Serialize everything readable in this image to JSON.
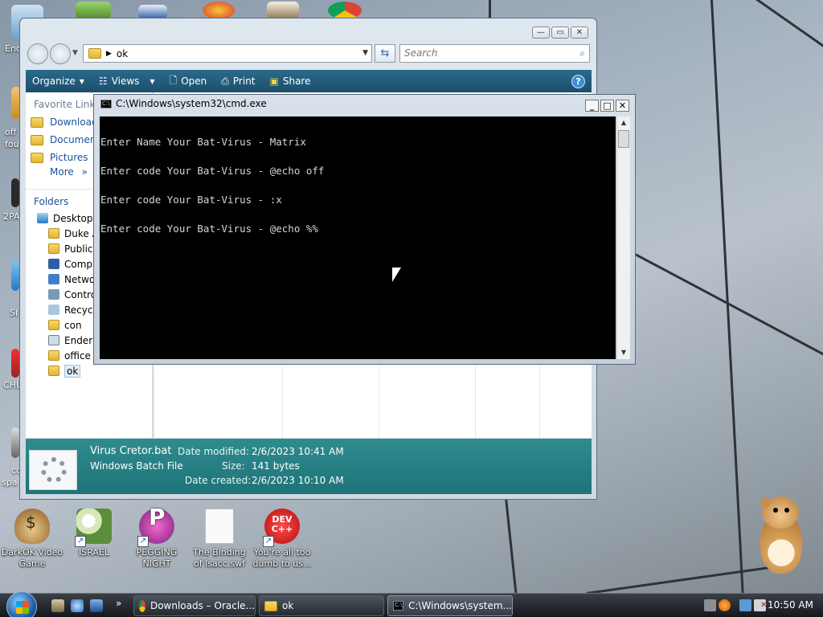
{
  "desktop": {
    "icons": [
      {
        "label_line1": "DarkOK Video",
        "label_line2": "Game"
      },
      {
        "label_line1": "ISRAEL",
        "label_line2": ""
      },
      {
        "label_line1": "PEGGING",
        "label_line2": "NIGHT"
      },
      {
        "label_line1": "The Binding",
        "label_line2": "of Isacc.swf"
      },
      {
        "label_line1": "You're all too",
        "label_line2": "dumb to us..."
      }
    ],
    "partial_labels": [
      "Enc",
      "off",
      "fou",
      "2PA",
      "SI",
      "CHU",
      "co",
      "spa"
    ],
    "dev_icon_text": "DEV\nC++"
  },
  "explorer": {
    "address": "ok",
    "search_placeholder": "Search",
    "toolbar": {
      "organize": "Organize",
      "views": "Views",
      "open": "Open",
      "print": "Print",
      "share": "Share",
      "help": "?"
    },
    "favorite_links_header": "Favorite Links",
    "favorites": [
      "Download",
      "Document",
      "Pictures"
    ],
    "more": "More",
    "folders_header": "Folders",
    "tree": [
      "Desktop",
      "Duke A",
      "Public",
      "Comp",
      "Netwo",
      "Contro",
      "Recycl",
      "con",
      "Enderr",
      "office",
      "ok"
    ],
    "details": {
      "file_name": "Virus Cretor.bat",
      "file_type": "Windows Batch File",
      "date_modified_label": "Date modified:",
      "date_modified": "2/6/2023 10:41 AM",
      "size_label": "Size:",
      "size": "141 bytes",
      "date_created_label": "Date created:",
      "date_created": "2/6/2023 10:10 AM"
    }
  },
  "cmd": {
    "title": "C:\\Windows\\system32\\cmd.exe",
    "lines": [
      "Enter Name Your Bat-Virus - Matrix",
      "Enter code Your Bat-Virus - @echo off",
      "Enter code Your Bat-Virus - :x",
      "Enter code Your Bat-Virus - @echo %%"
    ]
  },
  "taskbar": {
    "buttons": [
      "Downloads – Oracle...",
      "ok",
      "C:\\Windows\\system..."
    ],
    "clock": "10:50 AM"
  },
  "colors": {
    "toolbar": "#1c4e6c",
    "details_pane": "#1f7378",
    "cmd_background": "#000000",
    "cmd_text": "#d6d6d6"
  }
}
